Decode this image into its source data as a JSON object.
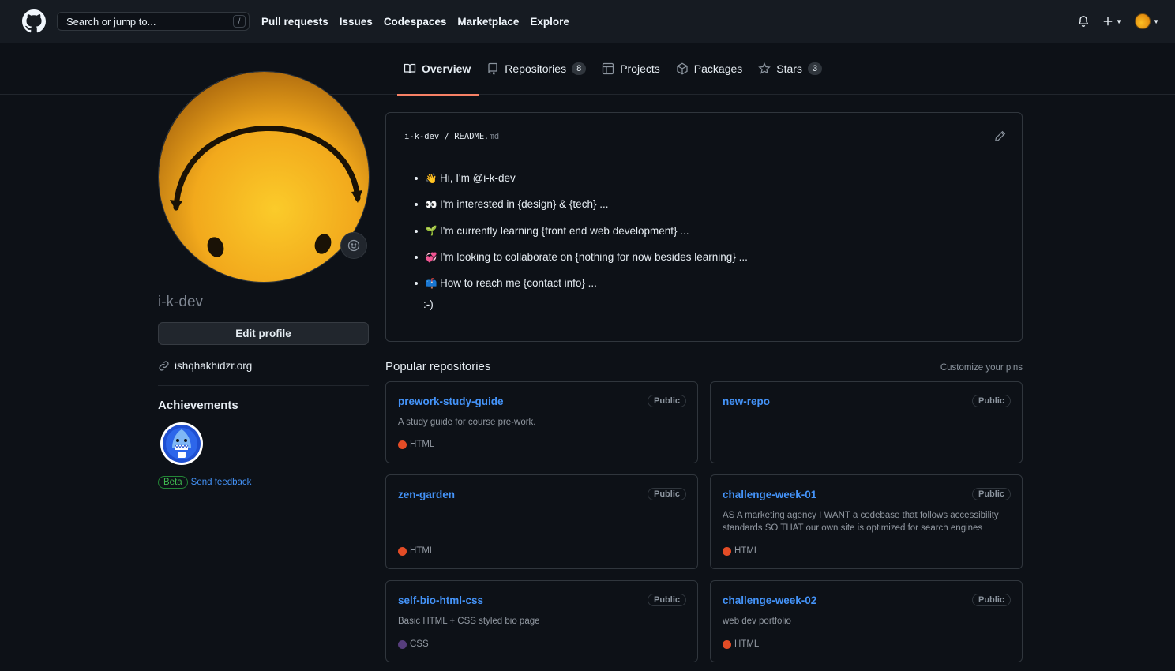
{
  "header": {
    "search_placeholder": "Search or jump to...",
    "search_shortcut": "/",
    "nav": [
      "Pull requests",
      "Issues",
      "Codespaces",
      "Marketplace",
      "Explore"
    ],
    "icons": [
      "github-logo",
      "bell-icon",
      "plus-icon",
      "avatar"
    ]
  },
  "tabs": [
    {
      "label": "Overview",
      "icon": "book-icon",
      "active": true
    },
    {
      "label": "Repositories",
      "icon": "repo-icon",
      "count": "8"
    },
    {
      "label": "Projects",
      "icon": "table-icon"
    },
    {
      "label": "Packages",
      "icon": "package-icon"
    },
    {
      "label": "Stars",
      "icon": "star-icon",
      "count": "3"
    }
  ],
  "profile": {
    "username": "i-k-dev",
    "edit_label": "Edit profile",
    "website": "ishqhakhidzr.org",
    "achievements_title": "Achievements",
    "beta_label": "Beta",
    "feedback_label": "Send feedback"
  },
  "readme": {
    "owner": "i-k-dev",
    "separator": " / ",
    "file_base": "README",
    "file_ext": ".md",
    "items": [
      {
        "emoji": "👋",
        "text": "Hi, I'm @i-k-dev"
      },
      {
        "emoji": "👀",
        "text": "I'm interested in {design} & {tech} ..."
      },
      {
        "emoji": "🌱",
        "text": "I'm currently learning {front end web development} ..."
      },
      {
        "emoji": "💞",
        "text": "I'm looking to collaborate on {nothing for now besides learning} ..."
      },
      {
        "emoji": "📫",
        "text": "How to reach me {contact info} ..."
      }
    ],
    "sign_off": ":-)"
  },
  "popular": {
    "title": "Popular repositories",
    "customize": "Customize your pins",
    "repos": [
      {
        "name": "prework-study-guide",
        "visibility": "Public",
        "description": "A study guide for course pre-work.",
        "language": "HTML",
        "lang_color": "#e34c26"
      },
      {
        "name": "new-repo",
        "visibility": "Public",
        "description": "",
        "language": "",
        "lang_color": ""
      },
      {
        "name": "zen-garden",
        "visibility": "Public",
        "description": "",
        "language": "HTML",
        "lang_color": "#e34c26"
      },
      {
        "name": "challenge-week-01",
        "visibility": "Public",
        "description": "AS A marketing agency I WANT a codebase that follows accessibility standards SO THAT our own site is optimized for search engines",
        "language": "HTML",
        "lang_color": "#e34c26"
      },
      {
        "name": "self-bio-html-css",
        "visibility": "Public",
        "description": "Basic HTML + CSS styled bio page",
        "language": "CSS",
        "lang_color": "#563d7c"
      },
      {
        "name": "challenge-week-02",
        "visibility": "Public",
        "description": "web dev portfolio",
        "language": "HTML",
        "lang_color": "#e34c26"
      }
    ]
  },
  "colors": {
    "accent_link": "#4493f8",
    "tab_underline": "#f78166",
    "beta_green": "#3fb950"
  }
}
